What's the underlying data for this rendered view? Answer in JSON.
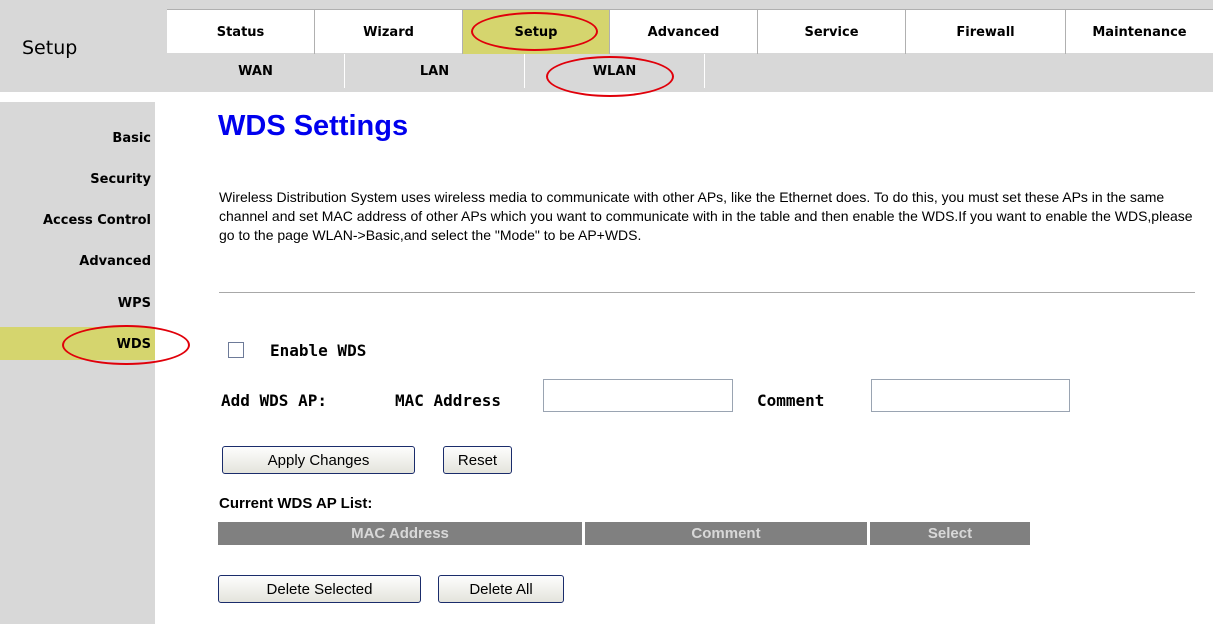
{
  "header": {
    "section_title": "Setup",
    "main_tabs": [
      {
        "label": "Status"
      },
      {
        "label": "Wizard"
      },
      {
        "label": "Setup"
      },
      {
        "label": "Advanced"
      },
      {
        "label": "Service"
      },
      {
        "label": "Firewall"
      },
      {
        "label": "Maintenance"
      }
    ],
    "active_main_tab": "Setup",
    "sub_tabs": [
      {
        "label": "WAN"
      },
      {
        "label": "LAN"
      },
      {
        "label": "WLAN"
      }
    ],
    "active_sub_tab": "WLAN"
  },
  "sidebar": {
    "items": [
      {
        "label": "Basic"
      },
      {
        "label": "Security"
      },
      {
        "label": "Access Control"
      },
      {
        "label": "Advanced"
      },
      {
        "label": "WPS"
      },
      {
        "label": "WDS"
      }
    ],
    "active_item": "WDS"
  },
  "main": {
    "heading": "WDS Settings",
    "description": "Wireless Distribution System uses wireless media to communicate with other APs, like the Ethernet does. To do this, you must set these APs in the same channel and set MAC address of other APs which you want to communicate with in the table and then enable the WDS.If you want to enable the WDS,please go to the page WLAN->Basic,and select the \"Mode\" to be AP+WDS.",
    "enable_wds_label": "Enable WDS",
    "enable_wds_checked": false,
    "add_wds_ap_label": "Add WDS AP:",
    "mac_address_label": "MAC Address",
    "mac_address_value": "",
    "comment_label": "Comment",
    "comment_value": "",
    "apply_button": "Apply Changes",
    "reset_button": "Reset",
    "list_title": "Current WDS AP List:",
    "table_columns": [
      "MAC Address",
      "Comment",
      "Select"
    ],
    "delete_selected_button": "Delete Selected",
    "delete_all_button": "Delete All"
  },
  "colors": {
    "active_highlight": "#d5d56e",
    "heading_blue": "#0000ee",
    "annotation_red": "#e0000a",
    "table_header_bg": "#808080"
  }
}
